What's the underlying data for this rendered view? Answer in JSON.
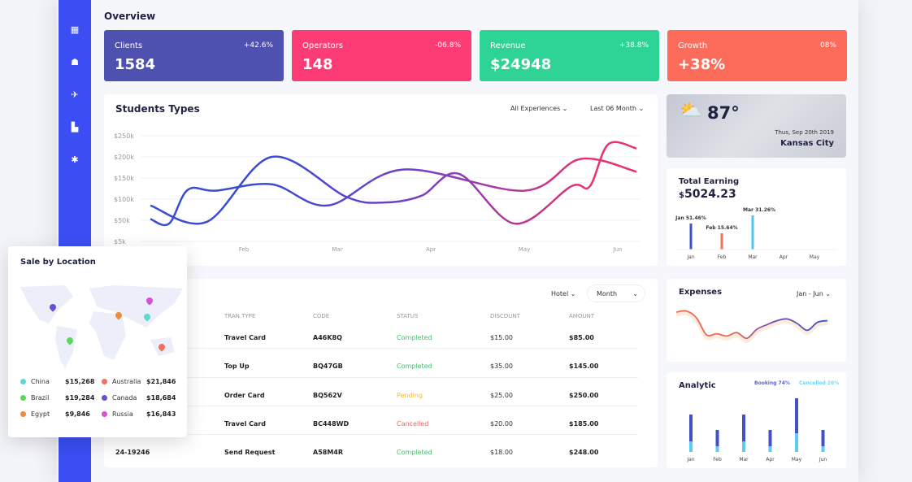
{
  "header": {
    "title": "Overview"
  },
  "sidebar": {
    "items": [
      {
        "icon": "dashboard-icon",
        "glyph": "▦"
      },
      {
        "icon": "user-icon",
        "glyph": "☗"
      },
      {
        "icon": "airplane-icon",
        "glyph": "✈"
      },
      {
        "icon": "building-icon",
        "glyph": "▙"
      },
      {
        "icon": "gear-icon",
        "glyph": "✱"
      }
    ]
  },
  "stats": [
    {
      "label": "Clients",
      "change": "+42.6%",
      "value": "1584",
      "color": "#4e51b0"
    },
    {
      "label": "Operators",
      "change": "-06.8%",
      "value": "148",
      "color": "#fd3c76"
    },
    {
      "label": "Revenue",
      "change": "+38.8%",
      "value": "$24948",
      "color": "#2ed396"
    },
    {
      "label": "Growth",
      "change": "08%",
      "value": "+38%",
      "color": "#fd6c5a"
    }
  ],
  "students": {
    "title": "Students Types",
    "filter1": "All Experiences",
    "filter2": "Last 06 Month"
  },
  "chart_data": [
    {
      "type": "line",
      "title": "Students Types",
      "y_ticks": [
        "$250k",
        "$200k",
        "$150k",
        "$100k",
        "$50k",
        "$5k"
      ],
      "x_ticks": [
        "Feb",
        "Mar",
        "Apr",
        "May",
        "Jun"
      ],
      "ylim": [
        0,
        250
      ],
      "grid": true,
      "series": [
        {
          "x": [
            1.0,
            1.6,
            2.3,
            3.1,
            3.5,
            3.9,
            4.3,
            4.9,
            5.5,
            5.7,
            5.9,
            6.2
          ],
          "y": [
            85,
            46,
            200,
            105,
            92,
            108,
            160,
            42,
            130,
            130,
            230,
            220
          ]
        },
        {
          "x": [
            1.0,
            1.2,
            1.4,
            1.7,
            2.3,
            2.9,
            3.7,
            5.0,
            5.6,
            6.2
          ],
          "y": [
            53,
            42,
            122,
            120,
            135,
            85,
            170,
            120,
            195,
            165
          ]
        }
      ]
    },
    {
      "type": "bar",
      "title": "Total Earning",
      "categories": [
        "Jan",
        "Feb",
        "Mar",
        "Apr",
        "May"
      ],
      "labels": [
        "Jan 51.46%",
        "Feb 15.64%",
        "Mar 31.26%",
        "",
        ""
      ],
      "values": [
        51.46,
        15.64,
        31.26,
        0,
        0
      ],
      "colors": [
        "#3f51c8",
        "#f0705a",
        "#4fc6ea"
      ]
    },
    {
      "type": "line",
      "title": "Expenses",
      "range": "Jan - Jun",
      "y": [
        70,
        72,
        60,
        30,
        32,
        28,
        34,
        24,
        40,
        48,
        55,
        58,
        50,
        38,
        52,
        55
      ]
    },
    {
      "type": "bar",
      "title": "Analytic",
      "categories": [
        "Jan",
        "Feb",
        "Mar",
        "Apr",
        "May",
        "Jun"
      ],
      "series": [
        {
          "name": "Booking 74%",
          "values": [
            33,
            20,
            33,
            20,
            43,
            20
          ],
          "color": "#4252c4"
        },
        {
          "name": "Cancelled 26%",
          "values": [
            13,
            7,
            13,
            7,
            23,
            7
          ],
          "color": "#5ccaf1"
        }
      ]
    }
  ],
  "weather": {
    "temp": "87°",
    "date": "Thus, Sep 20th 2019",
    "city": "Kansas City"
  },
  "earning": {
    "title": "Total Earning",
    "currency": "$",
    "amount": "5024.23"
  },
  "expenses": {
    "title": "Expenses",
    "range": "Jan - Jun"
  },
  "analytic": {
    "title": "Analytic",
    "booking": "Booking 74%",
    "cancelled": "Cancelled 26%"
  },
  "table": {
    "filter1": "Hotel",
    "filter2": "Month",
    "headers": [
      "TRAN.TYPE",
      "CODE",
      "STATUS",
      "DISCOUNT",
      "AMOUNT"
    ],
    "rows": [
      {
        "id": "",
        "type": "Travel Card",
        "code": "A46K8Q",
        "status": "Completed",
        "discount": "$15.00",
        "amount": "$85.00"
      },
      {
        "id": "",
        "type": "Top Up",
        "code": "BQ47GB",
        "status": "Completed",
        "discount": "$35.00",
        "amount": "$145.00"
      },
      {
        "id": "",
        "type": "Order Card",
        "code": "BQ562V",
        "status": "Pending",
        "discount": "$25.00",
        "amount": "$250.00"
      },
      {
        "id": "",
        "type": "Travel Card",
        "code": "BC448WD",
        "status": "Cancelled",
        "discount": "$20.00",
        "amount": "$185.00"
      },
      {
        "id": "24-19246",
        "type": "Send Request",
        "code": "A58M4R",
        "status": "Completed",
        "discount": "$18.00",
        "amount": "$248.00"
      }
    ],
    "status_colors": {
      "Completed": "#3cc36b",
      "Pending": "#f5b841",
      "Cancelled": "#f06060"
    }
  },
  "location": {
    "title": "Sale by Location",
    "items": [
      {
        "country": "China",
        "value": "$15,268",
        "color": "#5fd6cf"
      },
      {
        "country": "Australia",
        "value": "$21,846",
        "color": "#f0705a"
      },
      {
        "country": "Brazil",
        "value": "$19,284",
        "color": "#5cd65c"
      },
      {
        "country": "Canada",
        "value": "$18,684",
        "color": "#6a4fd6"
      },
      {
        "country": "Egypt",
        "value": "$9,846",
        "color": "#f08a3c"
      },
      {
        "country": "Russia",
        "value": "$16,843",
        "color": "#d94fd6"
      }
    ]
  }
}
